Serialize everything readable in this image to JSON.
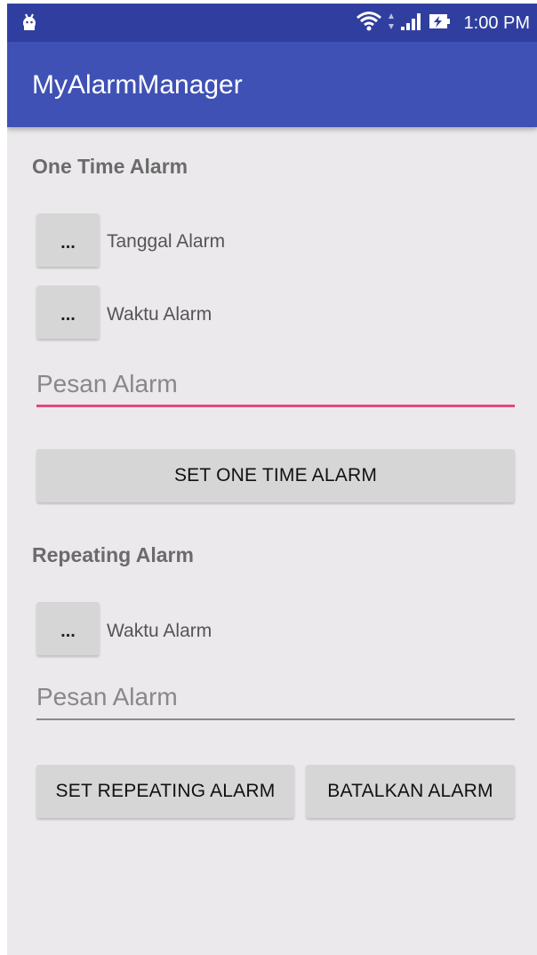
{
  "status_bar": {
    "time": "1:00 PM",
    "left_icon": "android-debug-icon",
    "icons": [
      "wifi-icon",
      "signal-icon",
      "battery-charging-icon"
    ]
  },
  "app_bar": {
    "title": "MyAlarmManager",
    "color": "#3f51b5"
  },
  "one_time": {
    "section_title": "One Time Alarm",
    "date_button_label": "...",
    "date_label": "Tanggal Alarm",
    "time_button_label": "...",
    "time_label": "Waktu Alarm",
    "message_placeholder": "Pesan Alarm",
    "set_button_label": "SET ONE TIME ALARM"
  },
  "repeating": {
    "section_title": "Repeating Alarm",
    "time_button_label": "...",
    "time_label": "Waktu Alarm",
    "message_placeholder": "Pesan Alarm",
    "set_button_label": "SET REPEATING ALARM",
    "cancel_button_label": "BATALKAN ALARM"
  },
  "colors": {
    "primary": "#3f51b5",
    "primary_dark": "#303f9f",
    "accent": "#e0487a"
  }
}
